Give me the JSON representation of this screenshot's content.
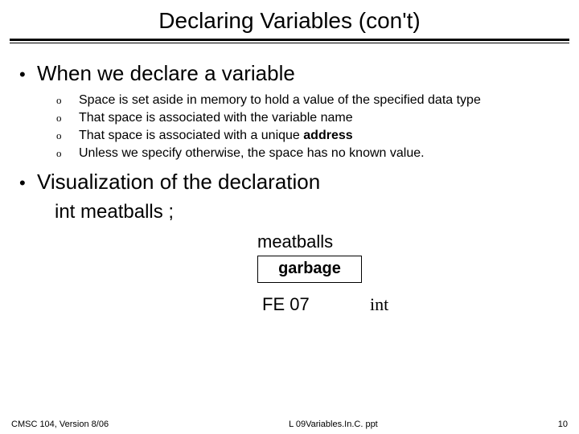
{
  "title": "Declaring Variables (con't)",
  "bullets": [
    {
      "text": "When we declare a variable",
      "subs": [
        "Space is set aside in memory to hold a value of the specified data type",
        "That space is associated with the variable name",
        "That space is associated with a unique address",
        "Unless we specify otherwise, the space has no known value."
      ]
    },
    {
      "text": "Visualization of the declaration",
      "subs": []
    }
  ],
  "code": "int  meatballs ;",
  "viz": {
    "top": "meatballs",
    "box": "garbage",
    "left": "FE 07",
    "right": "int"
  },
  "footer": {
    "left": "CMSC 104, Version 8/06",
    "center": "L 09Variables.In.C. ppt",
    "right": "10"
  },
  "bold_word": "address"
}
